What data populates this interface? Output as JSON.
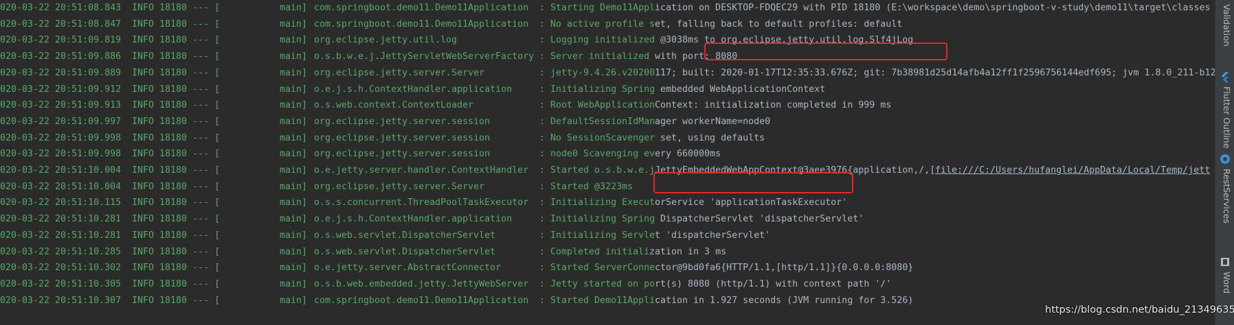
{
  "colors": {
    "background": "#2b2b2b",
    "log_text": "#59a869",
    "highlight_box": "#e22a2a",
    "link": "#287bde",
    "plain": "#a9b7c6"
  },
  "log": [
    {
      "ts": "020-03-22 20:51:08.843",
      "level": "INFO 18180 --- [",
      "thread": "main]",
      "logger": "com.springboot.demo11.Demo11Application",
      "msg": ": Starting Demo11Appl",
      "tail": "ication on DESKTOP-FDQEC29 with PID 18180 (E:\\workspace\\demo\\springboot-v-study\\demo11\\target\\classes"
    },
    {
      "ts": "020-03-22 20:51:08.847",
      "level": "INFO 18180 --- [",
      "thread": "main]",
      "logger": "com.springboot.demo11.Demo11Application",
      "msg": ": No active profile s",
      "tail": "et, falling back to default profiles: default"
    },
    {
      "ts": "020-03-22 20:51:09.819",
      "level": "INFO 18180 --- [",
      "thread": "main]",
      "logger": "org.eclipse.jetty.util.log",
      "msg": ": Logging initialized",
      "tail": " @3038ms to org.eclipse.jetty.util.log.Slf4jLog"
    },
    {
      "ts": "020-03-22 20:51:09.886",
      "level": "INFO 18180 --- [",
      "thread": "main]",
      "logger": "o.s.b.w.e.j.JettyServletWebServerFactory",
      "msg": ": Server initialized",
      "tail": " with port: 8080"
    },
    {
      "ts": "020-03-22 20:51:09.889",
      "level": "INFO 18180 --- [",
      "thread": "main]",
      "logger": "org.eclipse.jetty.server.Server",
      "msg": ": jetty-9.4.26.v20200",
      "tail": "117; built: 2020-01-17T12:35:33.676Z; git: 7b38981d25d14afb4a12ff1f2596756144edf695; jvm 1.8.0_211-b12"
    },
    {
      "ts": "020-03-22 20:51:09.912",
      "level": "INFO 18180 --- [",
      "thread": "main]",
      "logger": "o.e.j.s.h.ContextHandler.application",
      "msg": ": Initializing Spring",
      "tail": " embedded WebApplicationContext"
    },
    {
      "ts": "020-03-22 20:51:09.913",
      "level": "INFO 18180 --- [",
      "thread": "main]",
      "logger": "o.s.web.context.ContextLoader",
      "msg": ": Root WebApplication",
      "tail": "Context: initialization completed in 999 ms"
    },
    {
      "ts": "020-03-22 20:51:09.997",
      "level": "INFO 18180 --- [",
      "thread": "main]",
      "logger": "org.eclipse.jetty.server.session",
      "msg": ": DefaultSessionIdMan",
      "tail": "ager workerName=node0"
    },
    {
      "ts": "020-03-22 20:51:09.998",
      "level": "INFO 18180 --- [",
      "thread": "main]",
      "logger": "org.eclipse.jetty.server.session",
      "msg": ": No SessionScavenger",
      "tail": " set, using defaults"
    },
    {
      "ts": "020-03-22 20:51:09.998",
      "level": "INFO 18180 --- [",
      "thread": "main]",
      "logger": "org.eclipse.jetty.server.session",
      "msg": ": node0 Scavenging ev",
      "tail": "ery 660000ms"
    },
    {
      "ts": "020-03-22 20:51:10.004",
      "level": "INFO 18180 --- [",
      "thread": "main]",
      "logger": "o.e.jetty.server.handler.ContextHandler",
      "msg": ": Started o.s.b.w.e.j",
      "tail": "JettyEmbeddedWebAppContext@3aee3976{application,/,[",
      "link": "file:///C:/Users/hufanglei/AppData/Local/Temp/jett"
    },
    {
      "ts": "020-03-22 20:51:10.004",
      "level": "INFO 18180 --- [",
      "thread": "main]",
      "logger": "org.eclipse.jetty.server.Server",
      "msg": ": Started @3223ms",
      "tail": ""
    },
    {
      "ts": "020-03-22 20:51:10.115",
      "level": "INFO 18180 --- [",
      "thread": "main]",
      "logger": "o.s.s.concurrent.ThreadPoolTaskExecutor",
      "msg": ": Initializing Execut",
      "tail": "orService 'applicationTaskExecutor'"
    },
    {
      "ts": "020-03-22 20:51:10.281",
      "level": "INFO 18180 --- [",
      "thread": "main]",
      "logger": "o.e.j.s.h.ContextHandler.application",
      "msg": ": Initializing Spring",
      "tail": " DispatcherServlet 'dispatcherServlet'"
    },
    {
      "ts": "020-03-22 20:51:10.281",
      "level": "INFO 18180 --- [",
      "thread": "main]",
      "logger": "o.s.web.servlet.DispatcherServlet",
      "msg": ": Initializing Servle",
      "tail": "t 'dispatcherServlet'"
    },
    {
      "ts": "020-03-22 20:51:10.285",
      "level": "INFO 18180 --- [",
      "thread": "main]",
      "logger": "o.s.web.servlet.DispatcherServlet",
      "msg": ": Completed initiali",
      "tail": "zation in 3 ms"
    },
    {
      "ts": "020-03-22 20:51:10.302",
      "level": "INFO 18180 --- [",
      "thread": "main]",
      "logger": "o.e.jetty.server.AbstractConnector",
      "msg": ": Started ServerConne",
      "tail": "ctor@9bd0fa6{HTTP/1.1,[http/1.1]}{0.0.0.0:8080}"
    },
    {
      "ts": "020-03-22 20:51:10.305",
      "level": "INFO 18180 --- [",
      "thread": "main]",
      "logger": "o.s.b.web.embedded.jetty.JettyWebServer",
      "msg": ": Jetty started on po",
      "tail": "rt(s) 8080 (http/1.1) with context path '/'"
    },
    {
      "ts": "020-03-22 20:51:10.307",
      "level": "INFO 18180 --- [",
      "thread": "main]",
      "logger": "com.springboot.demo11.Demo11Application",
      "msg": ": Started Demo11Appli",
      "tail": "cation in 1.927 seconds (JVM running for 3.526)"
    }
  ],
  "sidebar": {
    "tabs": [
      {
        "label": "Validation",
        "icon": "validation-icon"
      },
      {
        "label": "Flutter Outline",
        "icon": "flutter-icon"
      },
      {
        "label": "RestServices",
        "icon": "rest-services-icon"
      },
      {
        "label": "Word",
        "icon": "word-book-icon"
      }
    ]
  },
  "watermark": "https://blog.csdn.net/baidu_21349635"
}
